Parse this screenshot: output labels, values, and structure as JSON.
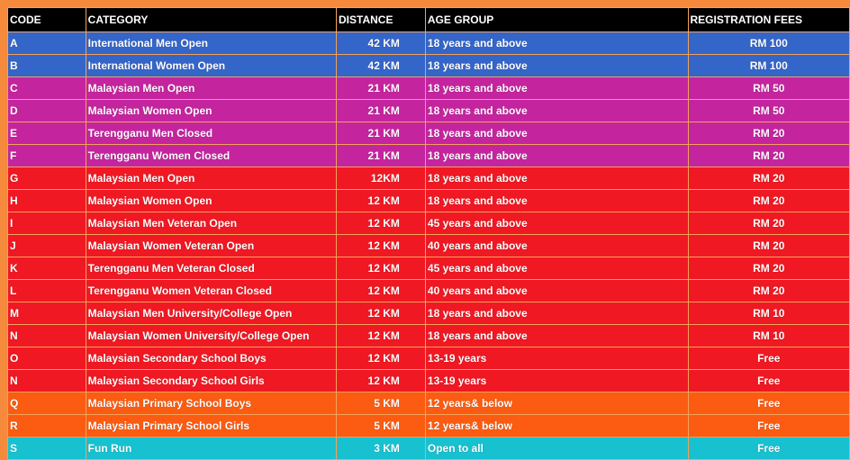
{
  "table": {
    "headers": [
      "CODE",
      "CATEGORY",
      "DISTANCE",
      "AGE GROUP",
      "REGISTRATION FEES"
    ],
    "colors": {
      "blue": "#3465c9",
      "magenta": "#c5249f",
      "red": "#f01822",
      "orange": "#fb5c12",
      "cyan": "#17c1d0"
    },
    "rows": [
      {
        "code": "A",
        "category": "International Men Open",
        "distance": "42 KM",
        "age": "18 years and above",
        "fee": "RM 100",
        "color": "#3465c9"
      },
      {
        "code": "B",
        "category": "International Women Open",
        "distance": "42 KM",
        "age": "18 years and above",
        "fee": "RM 100",
        "color": "#3465c9"
      },
      {
        "code": "C",
        "category": "Malaysian Men Open",
        "distance": "21 KM",
        "age": "18 years and above",
        "fee": "RM 50",
        "color": "#c5249f"
      },
      {
        "code": "D",
        "category": "Malaysian Women Open",
        "distance": "21 KM",
        "age": "18 years and above",
        "fee": "RM 50",
        "color": "#c5249f"
      },
      {
        "code": "E",
        "category": "Terengganu Men Closed",
        "distance": "21 KM",
        "age": "18 years and above",
        "fee": "RM 20",
        "color": "#c5249f"
      },
      {
        "code": "F",
        "category": "Terengganu Women Closed",
        "distance": "21 KM",
        "age": "18 years and above",
        "fee": "RM 20",
        "color": "#c5249f"
      },
      {
        "code": "G",
        "category": "Malaysian Men Open",
        "distance": "12KM",
        "age": "18 years and above",
        "fee": "RM 20",
        "color": "#f01822"
      },
      {
        "code": "H",
        "category": "Malaysian Women Open",
        "distance": "12 KM",
        "age": "18 years and above",
        "fee": "RM 20",
        "color": "#f01822"
      },
      {
        "code": "I",
        "category": "Malaysian Men Veteran Open",
        "distance": "12 KM",
        "age": "45 years and above",
        "fee": "RM 20",
        "color": "#f01822"
      },
      {
        "code": "J",
        "category": "Malaysian Women Veteran Open",
        "distance": "12 KM",
        "age": "40 years and above",
        "fee": "RM 20",
        "color": "#f01822"
      },
      {
        "code": "K",
        "category": "Terengganu Men Veteran Closed",
        "distance": "12 KM",
        "age": "45 years and above",
        "fee": "RM 20",
        "color": "#f01822"
      },
      {
        "code": "L",
        "category": "Terengganu Women Veteran Closed",
        "distance": "12 KM",
        "age": "40 years and above",
        "fee": "RM 20",
        "color": "#f01822"
      },
      {
        "code": "M",
        "category": "Malaysian Men University/College Open",
        "distance": "12 KM",
        "age": "18 years and above",
        "fee": "RM 10",
        "color": "#f01822"
      },
      {
        "code": "N",
        "category": "Malaysian Women University/College Open",
        "distance": "12 KM",
        "age": "18 years and above",
        "fee": "RM 10",
        "color": "#f01822"
      },
      {
        "code": "O",
        "category": "Malaysian Secondary School Boys",
        "distance": "12 KM",
        "age": "13-19 years",
        "fee": "Free",
        "color": "#f01822"
      },
      {
        "code": "N",
        "category": "Malaysian Secondary School Girls",
        "distance": "12 KM",
        "age": "13-19 years",
        "fee": "Free",
        "color": "#f01822"
      },
      {
        "code": "Q",
        "category": "Malaysian Primary School Boys",
        "distance": "5 KM",
        "age": "12 years& below",
        "fee": "Free",
        "color": "#fb5c12"
      },
      {
        "code": "R",
        "category": "Malaysian Primary School Girls",
        "distance": "5 KM",
        "age": "12 years& below",
        "fee": "Free",
        "color": "#fb5c12"
      },
      {
        "code": "S",
        "category": "Fun Run",
        "distance": "3 KM",
        "age": "Open to all",
        "fee": "Free",
        "color": "#17c1d0"
      }
    ]
  }
}
